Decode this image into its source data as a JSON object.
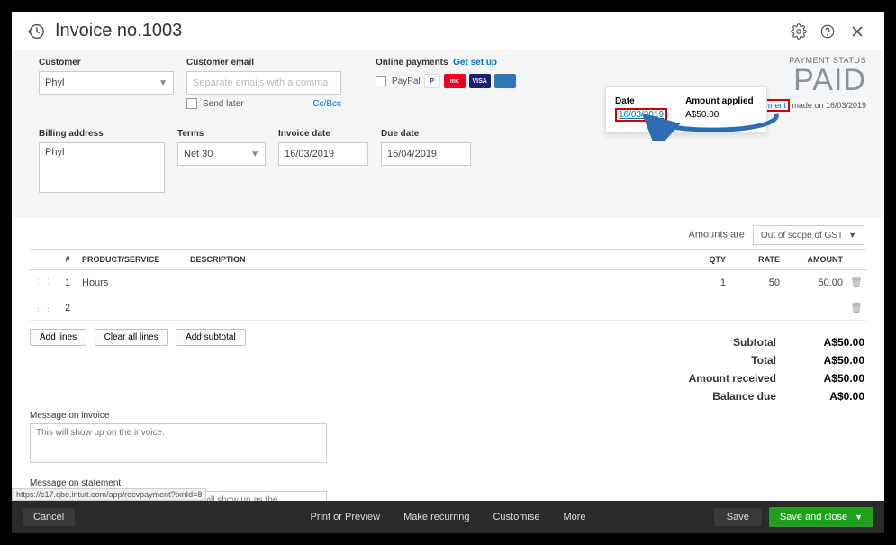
{
  "header": {
    "title": "Invoice no.1003"
  },
  "customer": {
    "label": "Customer",
    "value": "Phyl"
  },
  "customer_email": {
    "label": "Customer email",
    "placeholder": "Separate emails with a comma",
    "send_later": "Send later",
    "ccbcc": "Cc/Bcc"
  },
  "online_payments": {
    "label": "Online payments",
    "setup_link": "Get set up",
    "paypal_label": "PayPal"
  },
  "paid": {
    "status_label": "PAYMENT STATUS",
    "status": "PAID",
    "link_text": "1 payment",
    "note_suffix": "made on 16/03/2019"
  },
  "popover": {
    "date_label": "Date",
    "date_value": "16/03/2019",
    "amount_label": "Amount applied",
    "amount_value": "A$50.00"
  },
  "billing": {
    "label": "Billing address",
    "value": "Phyl"
  },
  "terms": {
    "label": "Terms",
    "value": "Net 30"
  },
  "invoice_date": {
    "label": "Invoice date",
    "value": "16/03/2019"
  },
  "due_date": {
    "label": "Due date",
    "value": "15/04/2019"
  },
  "amounts_are": {
    "label": "Amounts are",
    "value": "Out of scope of GST"
  },
  "table": {
    "headers": {
      "num": "#",
      "product": "PRODUCT/SERVICE",
      "desc": "DESCRIPTION",
      "qty": "QTY",
      "rate": "RATE",
      "amount": "AMOUNT"
    },
    "rows": [
      {
        "idx": "1",
        "product": "Hours",
        "desc": "",
        "qty": "1",
        "rate": "50",
        "amount": "50.00"
      },
      {
        "idx": "2",
        "product": "",
        "desc": "",
        "qty": "",
        "rate": "",
        "amount": ""
      }
    ],
    "add_lines": "Add lines",
    "clear_all": "Clear all lines",
    "add_subtotal": "Add subtotal"
  },
  "totals": {
    "subtotal_l": "Subtotal",
    "subtotal_v": "A$50.00",
    "total_l": "Total",
    "total_v": "A$50.00",
    "received_l": "Amount received",
    "received_v": "A$50.00",
    "balance_l": "Balance due",
    "balance_v": "A$0.00"
  },
  "msg_invoice": {
    "label": "Message on invoice",
    "placeholder": "This will show up on the invoice."
  },
  "msg_statement": {
    "label": "Message on statement",
    "placeholder": "If you send statements to customers, this will show up as the description for this invoice."
  },
  "footer": {
    "cancel": "Cancel",
    "print": "Print or Preview",
    "recurring": "Make recurring",
    "customise": "Customise",
    "more": "More",
    "save": "Save",
    "save_close": "Save and close"
  },
  "browser_status": "https://c17.qbo.intuit.com/app/recvpayment?txnId=8"
}
